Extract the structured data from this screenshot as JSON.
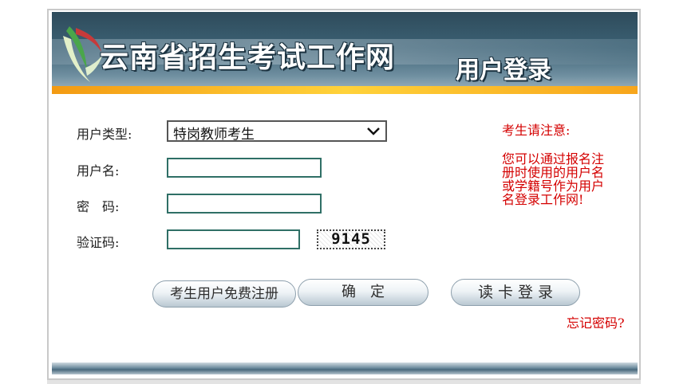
{
  "header": {
    "site_title": "云南省招生考试工作网",
    "page_title": "用户登录"
  },
  "form": {
    "user_type_label": "用户类型:",
    "user_type_value": "特岗教师考生",
    "username_label": "用户名:",
    "username_value": "",
    "password_label": "密　码:",
    "password_value": "",
    "captcha_label": "验证码:",
    "captcha_value": "",
    "captcha_image_text": "9145"
  },
  "notice": {
    "title": "考生请注意:",
    "body": "您可以通过报名注册时使用的用户名或学籍号作为用户名登录工作网!"
  },
  "buttons": {
    "register": "考生用户免费注册",
    "confirm": "确　定",
    "card_login": "读 卡 登 录"
  },
  "links": {
    "forgot_password": "忘记密码?"
  },
  "colors": {
    "notice_red": "#d40000",
    "header_blue": "#3c6174",
    "accent_orange": "#f7a51b",
    "input_border": "#2f6f66"
  }
}
